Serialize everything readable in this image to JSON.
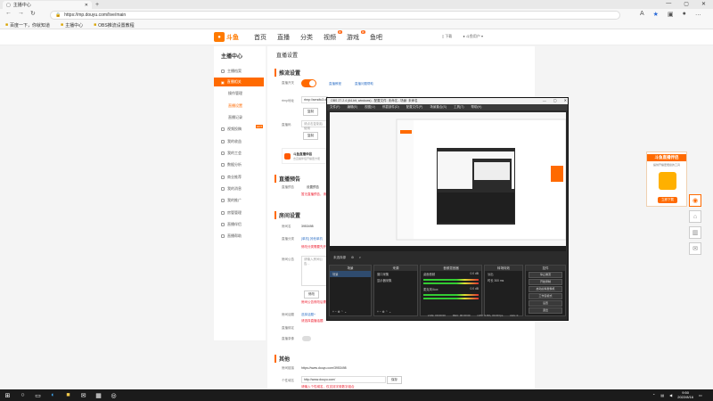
{
  "browser": {
    "tab_title": "主播中心",
    "new_tab": "+",
    "url": "https://mp.douyu.com/live/main",
    "favorites": [
      {
        "icon": "folder-icon",
        "label": "百度一下，你就知道"
      },
      {
        "icon": "folder-icon",
        "label": "主播中心"
      },
      {
        "icon": "folder-icon",
        "label": "OBS推流设置教程"
      }
    ]
  },
  "site": {
    "logo_text": "斗鱼",
    "nav": [
      {
        "label": "首页"
      },
      {
        "label": "直播"
      },
      {
        "label": "分类"
      },
      {
        "label": "视频",
        "badge": "新"
      },
      {
        "label": "游戏",
        "badge": "新"
      },
      {
        "label": "鱼吧"
      }
    ],
    "header_right": {
      "download": "下载",
      "user": "斗鱼用户"
    }
  },
  "sidebar": {
    "title": "主播中心",
    "items": [
      {
        "label": "主播档案"
      },
      {
        "label": "直播相关",
        "active": true
      },
      {
        "label": "操作管理"
      },
      {
        "label": "直播设置"
      },
      {
        "label": "直播记录"
      },
      {
        "label": "视频投稿",
        "hot": "HOT"
      },
      {
        "label": "我的收益"
      },
      {
        "label": "我的工会"
      },
      {
        "label": "数据分析"
      },
      {
        "label": "商业推荐"
      },
      {
        "label": "我的消息"
      },
      {
        "label": "我的推广"
      },
      {
        "label": "房管管理"
      },
      {
        "label": "直播伴侣"
      },
      {
        "label": "直播帮助"
      }
    ]
  },
  "main": {
    "title": "直播设置",
    "push": {
      "section": "推流设置",
      "switch_label": "直播开关",
      "link1": "直播教程",
      "link2": "直播问题帮助",
      "rtmp_label": "rtmp地址",
      "rtmp_value": "rtmp://sendtc3.douyu.com/live",
      "copy": "复制",
      "code_label": "直播码",
      "code_placeholder": "请点击复制后使用",
      "copy2": "复制",
      "promo_title": "斗鱼直播伴侣",
      "promo_sub": "去直播伴侣开播更方便"
    },
    "preview": {
      "section": "直播预告",
      "label": "直播预告",
      "value": "设置预告",
      "hint": "暂无直播预告，请设置"
    },
    "room": {
      "section": "房间设置",
      "name_label": "房间名",
      "name_value": "3953498",
      "category_label": "直播分类",
      "category_value": "[单机] 其他单机",
      "category_warn": "修改分类需要先开播",
      "cover_label": "房间公告",
      "cover_placeholder": "请输入房间公告...",
      "cover_btn": "修改",
      "cover_warn": "房间公告修改后需审核",
      "topic_label": "房间话题",
      "topic_link": "选择话题+",
      "topic_warn": "请选择直播话题",
      "bind_label": "直播绑定",
      "record_label": "直播录像"
    },
    "other": {
      "section": "其他",
      "share_label": "房间链接",
      "share_value": "https://www.douyu.com/3953498",
      "custom_label": "个性域名",
      "custom_value": "http://www.douyu.com/",
      "custom_btn": "保存",
      "custom_warn": "请输入个性域名，仅支持字母数字组合"
    }
  },
  "obs": {
    "title": "OBS 27.2.4 (64-bit, windows) - 配置文件: 未命名 - 场景: 未命名",
    "menu": [
      "文件(F)",
      "编辑(E)",
      "视图(V)",
      "停靠部件(D)",
      "配置文件(P)",
      "场景集合(S)",
      "工具(T)",
      "帮助(H)"
    ],
    "status": "未选择源",
    "docks": {
      "scenes": {
        "title": "场景",
        "items": [
          "场景"
        ]
      },
      "sources": {
        "title": "来源",
        "items": [
          "窗口采集",
          "显示器采集"
        ]
      },
      "mixer": {
        "title": "音频混音器",
        "items": [
          "桌面音频",
          "麦克风/Aux"
        ],
        "levels": [
          "0.0 dB",
          "0.0 dB"
        ]
      },
      "transitions": {
        "title": "转场特效",
        "items": [
          "淡出",
          "时长 300 ms"
        ]
      },
      "controls": {
        "title": "控件",
        "buttons": [
          "停止推流",
          "开始录制",
          "启动虚拟摄像机",
          "工作室模式",
          "设置",
          "退出"
        ]
      }
    },
    "footer": {
      "live": "LIVE: 00:00:00",
      "rec": "REC: 00:00:00",
      "cpu": "CPU: 0.8%, 30.00 fps",
      "kb": "kb/s: 0"
    }
  },
  "right_panel": {
    "title": "斗鱼直播伴侣",
    "subtitle": "提供开播更便捷的工具",
    "button": "立即下载"
  },
  "taskbar": {
    "time": "9:50",
    "date": "2022/8/16"
  },
  "colors": {
    "brand": "#ff6a00",
    "link": "#3a78c9",
    "warn": "#e23333"
  }
}
